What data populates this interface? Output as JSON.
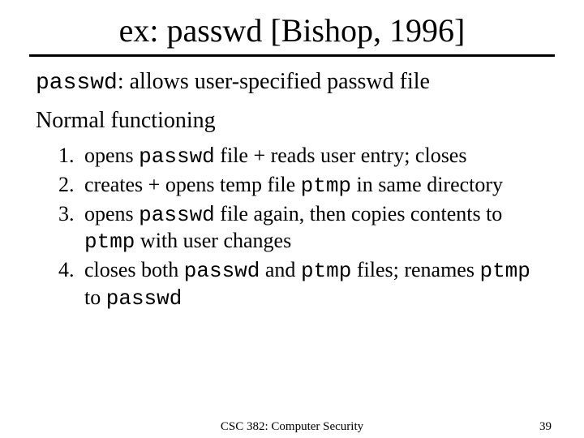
{
  "title": "ex: passwd [Bishop, 1996]",
  "intro": {
    "cmd": "passwd",
    "rest": ": allows user-specified passwd file"
  },
  "subhead": "Normal functioning",
  "items": {
    "i1a": "opens ",
    "i1b": "passwd",
    "i1c": " file + reads user entry; closes",
    "i2a": "creates + opens temp file ",
    "i2b": "ptmp",
    "i2c": " in same directory",
    "i3a": "opens ",
    "i3b": "passwd",
    "i3c": " file again, then copies contents to ",
    "i3d": "ptmp",
    "i3e": " with user changes",
    "i4a": "closes both ",
    "i4b": "passwd",
    "i4c": " and ",
    "i4d": "ptmp",
    "i4e": " files; renames ",
    "i4f": "ptmp",
    "i4g": " to ",
    "i4h": "passwd"
  },
  "footer": {
    "center": "CSC 382: Computer Security",
    "page": "39"
  }
}
